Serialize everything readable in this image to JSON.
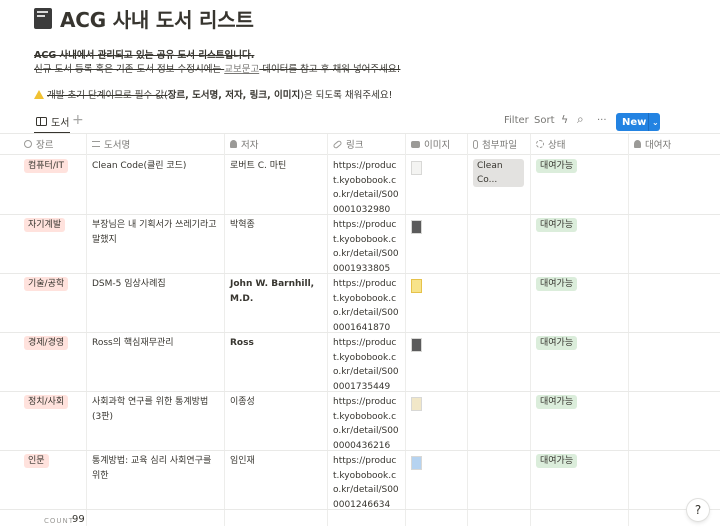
{
  "page": {
    "title": "ACG 사내 도서 리스트",
    "line1": "ACG 사내에서 관리되고 있는 공유 도서 리스트입니다.",
    "line2_pre": "신규 도서 등록 혹은 기존 도서 정보 수정시에는 ",
    "line2_link": "교보문고",
    "line2_post": " 데이터를 참고 후 채워 넣어주세요!",
    "line3_strike": "개발 초기 단계이므로 필수 값(",
    "line3_bold": "장르, 도서명, 저자, 링크, 이미지",
    "line3_post": ")은 되도록 채워주세요!"
  },
  "view": {
    "tab_label": "도서",
    "add": "+",
    "filter": "Filter",
    "sort": "Sort",
    "lightning": "ϟ",
    "search": "⌕",
    "more": "···",
    "new_label": "New",
    "new_chevron": "⌄"
  },
  "columns": [
    "장르",
    "도서명",
    "저자",
    "링크",
    "이미지",
    "첨부파일",
    "상태",
    "대여자"
  ],
  "rows": [
    {
      "genre": "컴퓨터/IT",
      "title": "Clean Code(클린 코드)",
      "author": "로버트 C. 마틴",
      "author_bold": false,
      "link": "https://product.kyobobook.co.kr/detail/S000001032980",
      "thumb": "light",
      "attachment": "Clean Co...",
      "status": "대여가능",
      "borrower": ""
    },
    {
      "genre": "자기계발",
      "title": "부장님은 내 기획서가 쓰레기라고 말했지",
      "author": "박혁종",
      "author_bold": false,
      "link": "https://product.kyobobook.co.kr/detail/S000001933805",
      "thumb": "dark",
      "attachment": "",
      "status": "대여가능",
      "borrower": ""
    },
    {
      "genre": "기술/공학",
      "title": "DSM-5 임상사례집",
      "author": "John W. Barnhill, M.D.",
      "author_bold": true,
      "link": "https://product.kyobobook.co.kr/detail/S000001641870",
      "thumb": "yellow",
      "attachment": "",
      "status": "대여가능",
      "borrower": ""
    },
    {
      "genre": "경제/경영",
      "title": "Ross의 핵심재무관리",
      "author": "Ross",
      "author_bold": true,
      "link": "https://product.kyobobook.co.kr/detail/S000001735449",
      "thumb": "dark",
      "attachment": "",
      "status": "대여가능",
      "borrower": ""
    },
    {
      "genre": "정치/사회",
      "title": "사회과학 연구를 위한 통계방법 (3판)",
      "author": "이종성",
      "author_bold": false,
      "link": "https://product.kyobobook.co.kr/detail/S000000436216",
      "thumb": "cream",
      "attachment": "",
      "status": "대여가능",
      "borrower": ""
    },
    {
      "genre": "인문",
      "title": "통계방법: 교육 심리 사회연구를 위한",
      "author": "임인재",
      "author_bold": false,
      "link": "https://product.kyobobook.co.kr/detail/S000001246634",
      "thumb": "blue",
      "attachment": "",
      "status": "대여가능",
      "borrower": ""
    }
  ],
  "footer": {
    "count_label": "COUNT",
    "count_value": "99"
  },
  "help": "?"
}
